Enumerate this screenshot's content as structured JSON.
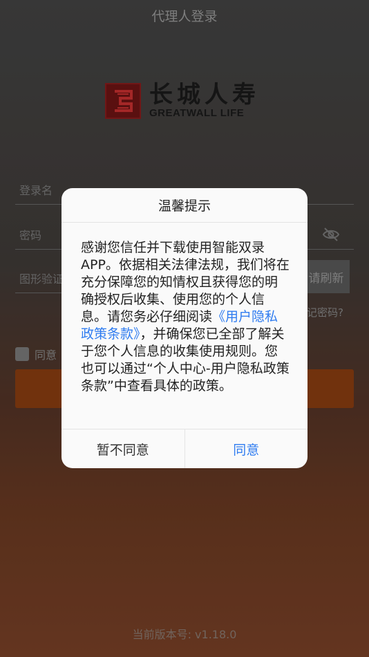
{
  "app": {
    "title": "代理人登录",
    "version": "当前版本号: v1.18.0"
  },
  "logo": {
    "text_cn": "长城人寿",
    "text_en": "GREATWALL LIFE"
  },
  "form": {
    "username_label": "登录名",
    "password_label": "密码",
    "captcha_label": "图形验证",
    "captcha_refresh": "请刷新",
    "forgot_password": "记密码?",
    "agree_label": "同意"
  },
  "dialog": {
    "title": "温馨提示",
    "body_part1": "感谢您信任并下载使用智能双录APP。依据相关法律法规，我们将在充分保障您的知情权且获得您的明确授权后收集、使用您的个人信息。请您务必仔细阅读",
    "policy_link": "《用户隐私政策条款》",
    "body_part2": "，并确保您已全部了解关于您个人信息的收集使用规则。您也可以通过“个人中心-用户隐私政策条款”中查看具体的政策。",
    "decline_label": "暂不同意",
    "accept_label": "同意"
  },
  "colors": {
    "accent": "#2f7cf0",
    "login_button": "#8a3d11",
    "logo_red": "#6e1414"
  }
}
